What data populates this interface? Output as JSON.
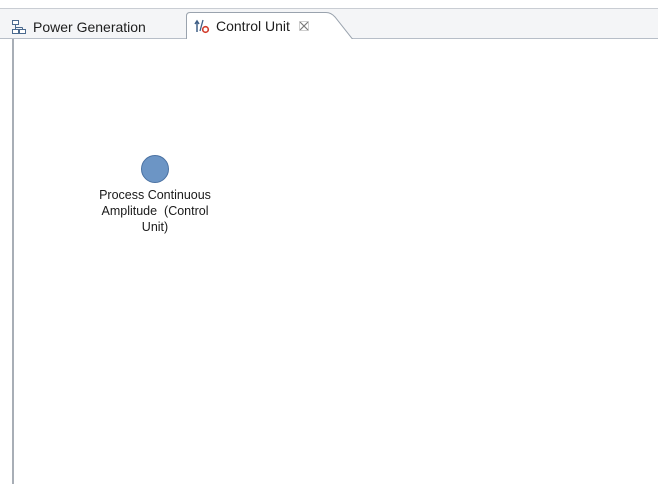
{
  "tabs": [
    {
      "label": "Power Generation",
      "icon": "diagram-icon",
      "active": false
    },
    {
      "label": "Control Unit",
      "icon": "control-flow-icon",
      "active": true,
      "closable": true
    }
  ],
  "diagram": {
    "nodes": [
      {
        "label_line1": "Process Continuous",
        "label_line2": "Amplitude  (Control",
        "label_line3": "Unit)",
        "color": "#6c95c5"
      }
    ]
  },
  "colors": {
    "node_fill": "#6c95c5",
    "tab_bar": "#f4f5f7",
    "border": "#a8aeb6"
  }
}
